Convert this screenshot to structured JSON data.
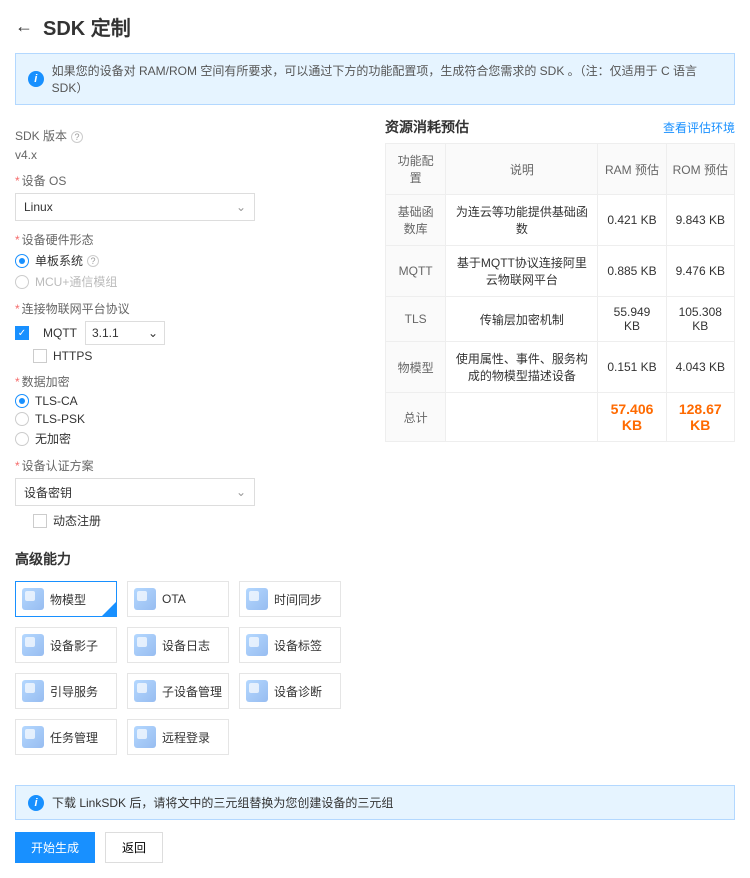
{
  "header": {
    "title": "SDK 定制"
  },
  "info_banner": "如果您的设备对 RAM/ROM 空间有所要求，可以通过下方的功能配置项，生成符合您需求的 SDK 。（注：仅适用于 C 语言 SDK）",
  "sdk_version": {
    "label": "SDK 版本",
    "value": "v4.x"
  },
  "device_os": {
    "label": "设备 OS",
    "value": "Linux"
  },
  "hardware": {
    "label": "设备硬件形态",
    "options": [
      {
        "label": "单板系统",
        "checked": true
      },
      {
        "label": "MCU+通信模组",
        "checked": false,
        "disabled": true
      }
    ]
  },
  "protocol": {
    "label": "连接物联网平台协议",
    "mqtt": {
      "label": "MQTT",
      "checked": true,
      "version": "3.1.1"
    },
    "https": {
      "label": "HTTPS",
      "checked": false
    }
  },
  "encryption": {
    "label": "数据加密",
    "options": [
      {
        "label": "TLS-CA",
        "checked": true
      },
      {
        "label": "TLS-PSK",
        "checked": false
      },
      {
        "label": "无加密",
        "checked": false
      }
    ]
  },
  "auth": {
    "label": "设备认证方案",
    "select_value": "设备密钥",
    "dynamic": {
      "label": "动态注册",
      "checked": false
    }
  },
  "advanced": {
    "title": "高级能力",
    "features": [
      {
        "label": "物模型",
        "selected": true
      },
      {
        "label": "OTA",
        "selected": false
      },
      {
        "label": "时间同步",
        "selected": false
      },
      {
        "label": "设备影子",
        "selected": false
      },
      {
        "label": "设备日志",
        "selected": false
      },
      {
        "label": "设备标签",
        "selected": false
      },
      {
        "label": "引导服务",
        "selected": false
      },
      {
        "label": "子设备管理",
        "selected": false
      },
      {
        "label": "设备诊断",
        "selected": false
      },
      {
        "label": "任务管理",
        "selected": false
      },
      {
        "label": "远程登录",
        "selected": false
      }
    ]
  },
  "resource": {
    "title": "资源消耗预估",
    "eval_link": "查看评估环境",
    "headers": [
      "功能配置",
      "说明",
      "RAM 预估",
      "ROM 预估"
    ],
    "rows": [
      {
        "name": "基础函数库",
        "desc": "为连云等功能提供基础函数",
        "ram": "0.421 KB",
        "rom": "9.843 KB"
      },
      {
        "name": "MQTT",
        "desc": "基于MQTT协议连接阿里云物联网平台",
        "ram": "0.885 KB",
        "rom": "9.476 KB"
      },
      {
        "name": "TLS",
        "desc": "传输层加密机制",
        "ram": "55.949 KB",
        "rom": "105.308 KB"
      },
      {
        "name": "物模型",
        "desc": "使用属性、事件、服务构成的物模型描述设备",
        "ram": "0.151 KB",
        "rom": "4.043 KB"
      }
    ],
    "total": {
      "label": "总计",
      "ram": "57.406 KB",
      "rom": "128.67 KB"
    }
  },
  "footer_banner": "下载 LinkSDK 后，请将文中的三元组替换为您创建设备的三元组",
  "buttons": {
    "start": "开始生成",
    "back": "返回"
  },
  "chart_data": {
    "type": "table",
    "title": "资源消耗预估",
    "columns": [
      "功能配置",
      "说明",
      "RAM 预估 (KB)",
      "ROM 预估 (KB)"
    ],
    "rows": [
      [
        "基础函数库",
        "为连云等功能提供基础函数",
        0.421,
        9.843
      ],
      [
        "MQTT",
        "基于MQTT协议连接阿里云物联网平台",
        0.885,
        9.476
      ],
      [
        "TLS",
        "传输层加密机制",
        55.949,
        105.308
      ],
      [
        "物模型",
        "使用属性、事件、服务构成的物模型描述设备",
        0.151,
        4.043
      ]
    ],
    "totals": {
      "RAM": 57.406,
      "ROM": 128.67
    }
  }
}
